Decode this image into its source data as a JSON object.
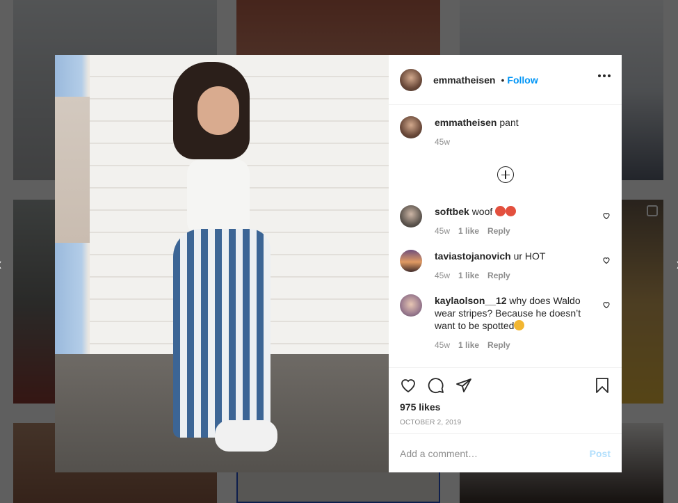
{
  "post": {
    "username": "emmatheisen",
    "dot": "•",
    "follow_label": "Follow",
    "caption": "pant",
    "caption_time": "45w",
    "likes": "975 likes",
    "date": "OCTOBER 2, 2019"
  },
  "comments": [
    {
      "username": "softbek",
      "text": "woof",
      "time": "45w",
      "likes": "1 like",
      "reply": "Reply"
    },
    {
      "username": "taviastojanovich",
      "text": "ur HOT",
      "time": "45w",
      "likes": "1 like",
      "reply": "Reply"
    },
    {
      "username": "kaylaolson__12",
      "text": "why does Waldo wear stripes? Because he doesn’t want to be spotted",
      "time": "45w",
      "likes": "1 like",
      "reply": "Reply"
    }
  ],
  "add_comment": {
    "placeholder": "Add a comment…",
    "post_label": "Post"
  },
  "icons": {
    "like": "heart-icon",
    "comment": "comment-icon",
    "share": "share-icon",
    "save": "bookmark-icon",
    "more": "more-options-icon",
    "load_more": "load-more-comments-icon",
    "prev": "chevron-left-icon",
    "next": "chevron-right-icon"
  },
  "colors": {
    "accent": "#0095f6",
    "post_disabled": "#b2dffc",
    "meta": "#8e8e8e"
  }
}
